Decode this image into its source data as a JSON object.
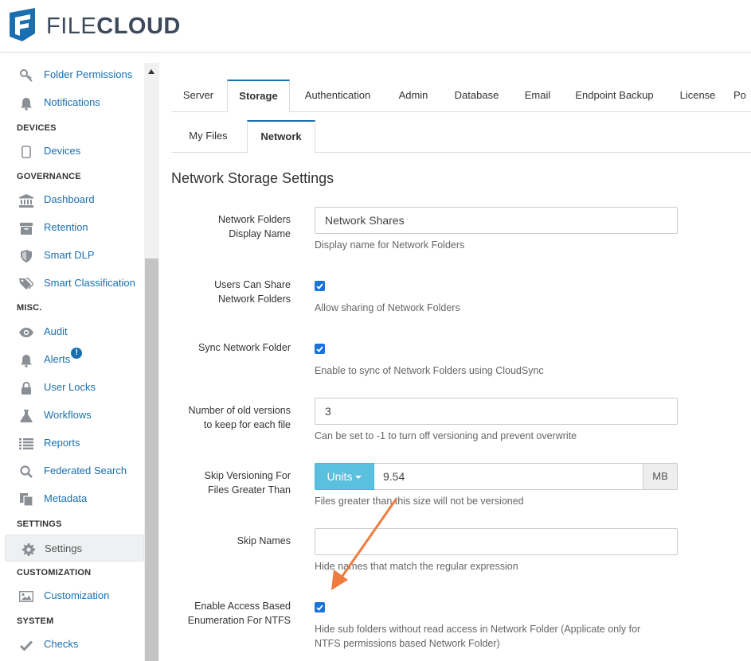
{
  "header": {
    "brand_part1": "FILE",
    "brand_part2": "CLOUD",
    "brand_color": "#3d4a5c",
    "logo_color": "#1a6fb0"
  },
  "sidebar": {
    "items_top": [
      {
        "label": "Folder Permissions",
        "icon": "key-icon"
      },
      {
        "label": "Notifications",
        "icon": "bell-icon"
      }
    ],
    "sections": {
      "devices": "DEVICES",
      "governance": "GOVERNANCE",
      "misc": "MISC.",
      "settings": "SETTINGS",
      "customization": "CUSTOMIZATION",
      "system": "SYSTEM"
    },
    "devices": {
      "label": "Devices",
      "icon": "device-icon"
    },
    "governance_items": [
      {
        "label": "Dashboard",
        "icon": "bank-icon"
      },
      {
        "label": "Retention",
        "icon": "archive-icon"
      },
      {
        "label": "Smart DLP",
        "icon": "shield-icon"
      },
      {
        "label": "Smart Classification",
        "icon": "tags-icon"
      }
    ],
    "misc_items": [
      {
        "label": "Audit",
        "icon": "eye-icon"
      },
      {
        "label": "Alerts",
        "icon": "bell-icon",
        "badge": "!"
      },
      {
        "label": "User Locks",
        "icon": "lock-icon"
      },
      {
        "label": "Workflows",
        "icon": "flask-icon"
      },
      {
        "label": "Reports",
        "icon": "list-icon"
      },
      {
        "label": "Federated Search",
        "icon": "search-icon"
      },
      {
        "label": "Metadata",
        "icon": "copy-icon"
      }
    ],
    "settings_item": {
      "label": "Settings",
      "icon": "gear-icon",
      "active": true
    },
    "customization_item": {
      "label": "Customization",
      "icon": "image-icon"
    },
    "system_item": {
      "label": "Checks",
      "icon": "check-icon"
    },
    "link_color": "#1a6fb0"
  },
  "tabs": [
    {
      "label": "Server"
    },
    {
      "label": "Storage",
      "active": true
    },
    {
      "label": "Authentication"
    },
    {
      "label": "Admin"
    },
    {
      "label": "Database"
    },
    {
      "label": "Email"
    },
    {
      "label": "Endpoint Backup"
    },
    {
      "label": "License"
    },
    {
      "label": "Po"
    }
  ],
  "subtabs": [
    {
      "label": "My Files"
    },
    {
      "label": "Network",
      "active": true
    }
  ],
  "form": {
    "title": "Network Storage Settings",
    "display_name": {
      "label_line1": "Network Folders",
      "label_line2": "Display Name",
      "value": "Network Shares",
      "help": "Display name for Network Folders"
    },
    "users_share": {
      "label_line1": "Users Can Share",
      "label_line2": "Network Folders",
      "checked": true,
      "help": "Allow sharing of Network Folders"
    },
    "sync": {
      "label": "Sync Network Folder",
      "checked": true,
      "help": "Enable to sync of Network Folders using CloudSync"
    },
    "old_versions": {
      "label_line1": "Number of old versions",
      "label_line2": "to keep for each file",
      "value": "3",
      "help": "Can be set to -1 to turn off versioning and prevent overwrite"
    },
    "skip_versioning": {
      "label_line1": "Skip Versioning For",
      "label_line2": "Files Greater Than",
      "units_label": "Units",
      "value": "9.54",
      "unit": "MB",
      "help": "Files greater than this size will not be versioned"
    },
    "skip_names": {
      "label": "Skip Names",
      "value": "",
      "help": "Hide names that match the regular expression"
    },
    "abe_ntfs": {
      "label_line1": "Enable Access Based",
      "label_line2": "Enumeration For NTFS",
      "checked": true,
      "help_line1": "Hide sub folders without read access in Network Folder (Applicate only for",
      "help_line2": "NTFS permissions based Network Folder)"
    }
  },
  "colors": {
    "accent": "#1a6fb0",
    "checkbox": "#1a73d9",
    "units_button": "#5bc0de",
    "annotation_arrow": "#f07b3f"
  }
}
